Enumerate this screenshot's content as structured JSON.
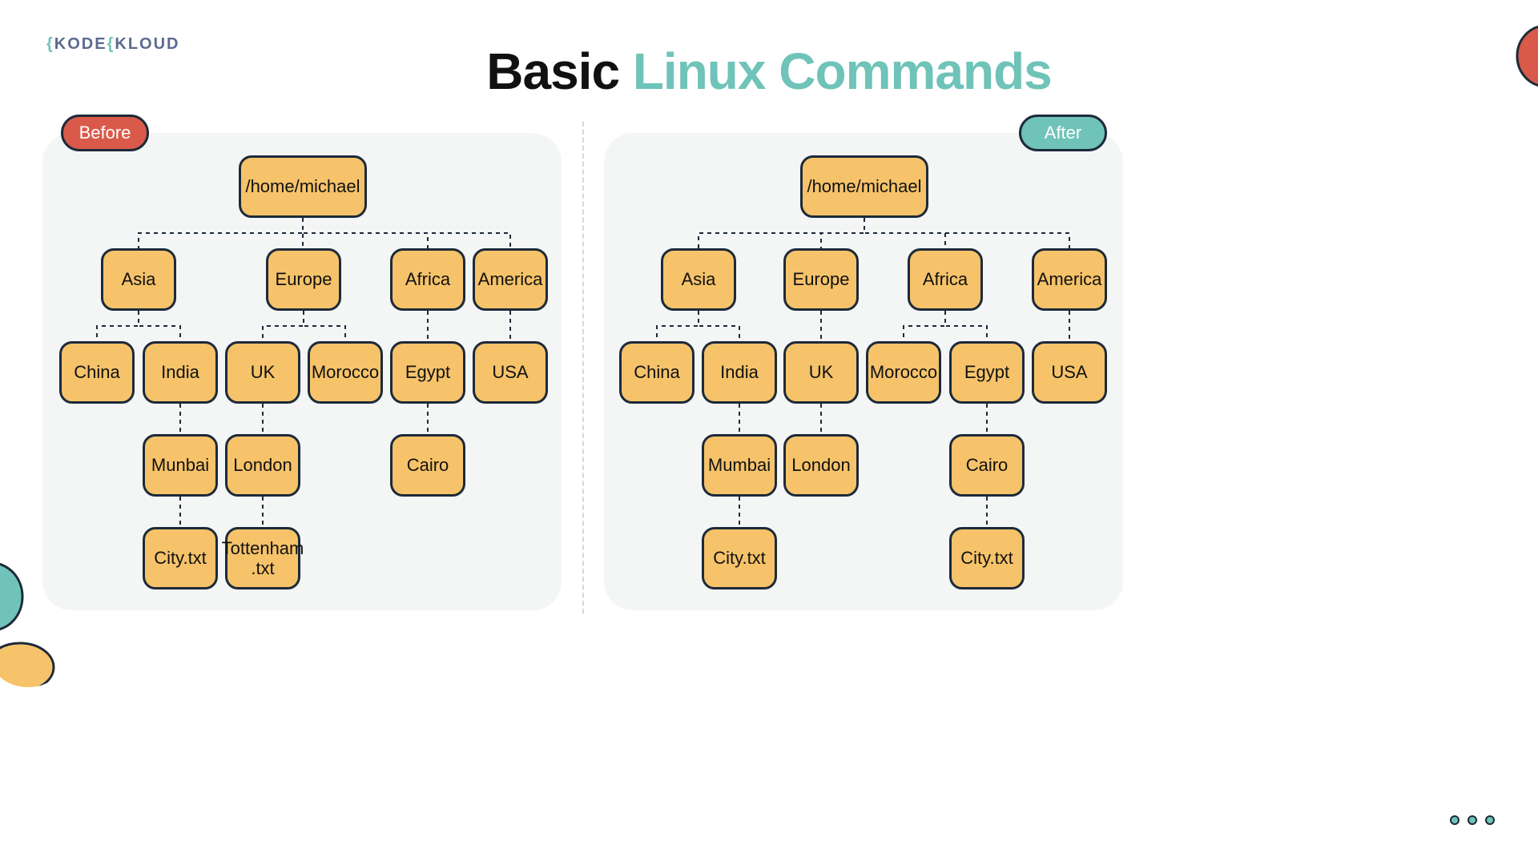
{
  "logo": {
    "left": "KODE",
    "right": "KLOUD"
  },
  "title": {
    "part1": "Basic ",
    "part2": "Linux Commands"
  },
  "labels": {
    "before": "Before",
    "after": "After"
  },
  "before": {
    "root": "/home/michael",
    "l1": {
      "asia": "Asia",
      "europe": "Europe",
      "africa": "Africa",
      "america": "America"
    },
    "l2": {
      "china": "China",
      "india": "India",
      "uk": "UK",
      "morocco": "Morocco",
      "egypt": "Egypt",
      "usa": "USA"
    },
    "l3": {
      "munbai": "Munbai",
      "london": "London",
      "cairo": "Cairo"
    },
    "l4": {
      "city": "City.txt",
      "tottenham": "Tottenham\n.txt"
    }
  },
  "after": {
    "root": "/home/michael",
    "l1": {
      "asia": "Asia",
      "europe": "Europe",
      "africa": "Africa",
      "america": "America"
    },
    "l2": {
      "china": "China",
      "india": "India",
      "uk": "UK",
      "morocco": "Morocco",
      "egypt": "Egypt",
      "usa": "USA"
    },
    "l3": {
      "mumbai": "Mumbai",
      "london": "London",
      "cairo": "Cairo"
    },
    "l4": {
      "city_india": "City.txt",
      "city_egypt": "City.txt"
    }
  }
}
